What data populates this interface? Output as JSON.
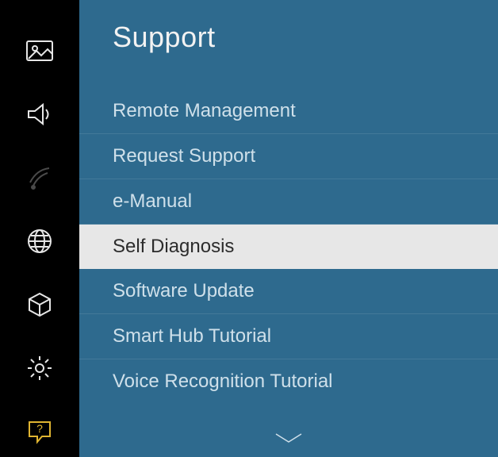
{
  "sidebar": {
    "items": [
      {
        "name": "picture-icon"
      },
      {
        "name": "sound-icon"
      },
      {
        "name": "broadcast-icon"
      },
      {
        "name": "network-icon"
      },
      {
        "name": "smart-hub-icon"
      },
      {
        "name": "system-icon"
      },
      {
        "name": "support-icon"
      }
    ]
  },
  "page": {
    "title": "Support"
  },
  "menu": {
    "items": [
      {
        "label": "Remote Management",
        "selected": false
      },
      {
        "label": "Request Support",
        "selected": false
      },
      {
        "label": "e-Manual",
        "selected": false
      },
      {
        "label": "Self Diagnosis",
        "selected": true
      },
      {
        "label": "Software Update",
        "selected": false
      },
      {
        "label": "Smart Hub Tutorial",
        "selected": false
      },
      {
        "label": "Voice Recognition Tutorial",
        "selected": false
      }
    ]
  }
}
